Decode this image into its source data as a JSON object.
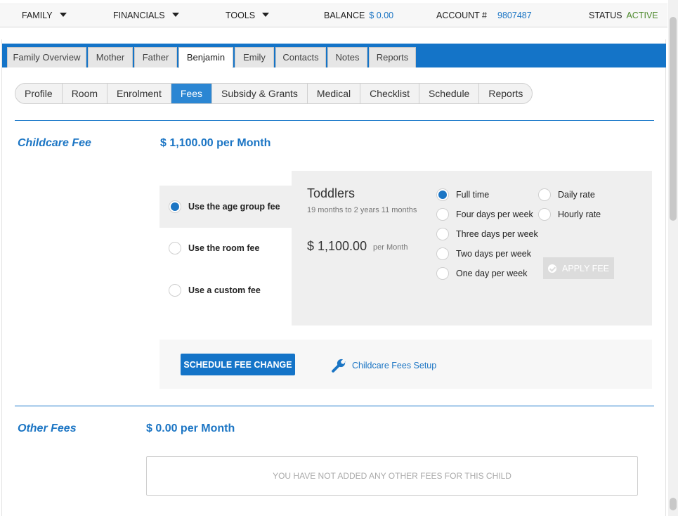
{
  "topbar": {
    "family_label": "FAMILY",
    "financials_label": "FINANCIALS",
    "tools_label": "TOOLS",
    "balance_label": "BALANCE",
    "balance_value": "$ 0.00",
    "account_label": "ACCOUNT #",
    "account_value": "9807487",
    "status_label": "STATUS",
    "status_value": "ACTIVE"
  },
  "tabs": [
    {
      "label": "Family Overview",
      "active": false
    },
    {
      "label": "Mother",
      "active": false
    },
    {
      "label": "Father",
      "active": false
    },
    {
      "label": "Benjamin",
      "active": true
    },
    {
      "label": "Emily",
      "active": false
    },
    {
      "label": "Contacts",
      "active": false
    },
    {
      "label": "Notes",
      "active": false
    },
    {
      "label": "Reports",
      "active": false
    }
  ],
  "subtabs": [
    {
      "label": "Profile",
      "active": false
    },
    {
      "label": "Room",
      "active": false
    },
    {
      "label": "Enrolment",
      "active": false
    },
    {
      "label": "Fees",
      "active": true
    },
    {
      "label": "Subsidy & Grants",
      "active": false
    },
    {
      "label": "Medical",
      "active": false
    },
    {
      "label": "Checklist",
      "active": false
    },
    {
      "label": "Schedule",
      "active": false
    },
    {
      "label": "Reports",
      "active": false
    }
  ],
  "childcare": {
    "title": "Childcare Fee",
    "amount": "$ 1,100.00 per Month",
    "options": [
      {
        "label": "Use the age group fee",
        "selected": true
      },
      {
        "label": "Use the room fee",
        "selected": false
      },
      {
        "label": "Use a custom fee",
        "selected": false
      }
    ],
    "group": {
      "name": "Toddlers",
      "range": "19 months to 2 years 11 months",
      "amount": "$ 1,100.00",
      "per": "per Month"
    },
    "schedule_options": [
      {
        "label": "Full time",
        "selected": true
      },
      {
        "label": "Four days per week",
        "selected": false
      },
      {
        "label": "Three days per week",
        "selected": false
      },
      {
        "label": "Two days per week",
        "selected": false
      },
      {
        "label": "One day per week",
        "selected": false
      }
    ],
    "rate_options": [
      {
        "label": "Daily rate",
        "selected": false
      },
      {
        "label": "Hourly rate",
        "selected": false
      }
    ],
    "apply_label": "APPLY FEE",
    "schedule_change_label": "SCHEDULE FEE CHANGE",
    "setup_link": "Childcare Fees Setup"
  },
  "other": {
    "title": "Other Fees",
    "amount": "$ 0.00 per Month",
    "empty_message": "YOU HAVE NOT ADDED ANY OTHER FEES FOR THIS CHILD"
  },
  "colors": {
    "accent": "#1474c8",
    "link": "#1b75c4",
    "status_active": "#4e8a2e"
  }
}
